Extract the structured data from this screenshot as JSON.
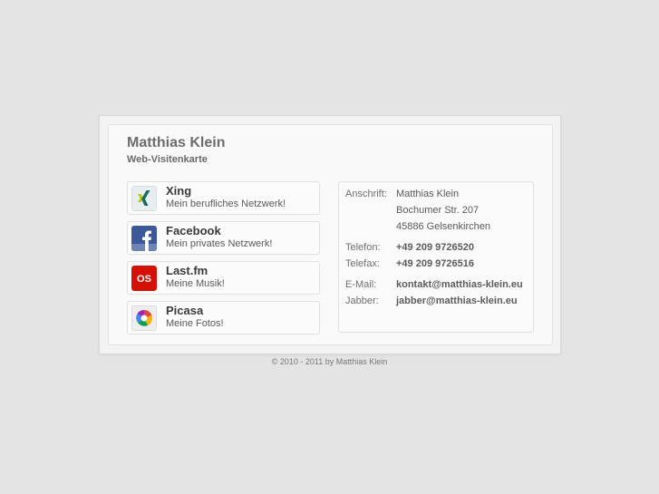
{
  "card": {
    "name": "Matthias Klein",
    "subtitle": "Web-Visitenkarte"
  },
  "links": [
    {
      "title": "Xing",
      "desc": "Mein berufliches Netzwerk!",
      "icon": "xing-icon"
    },
    {
      "title": "Facebook",
      "desc": "Mein privates Netzwerk!",
      "icon": "facebook-icon"
    },
    {
      "title": "Last.fm",
      "desc": "Meine Musik!",
      "icon": "lastfm-icon"
    },
    {
      "title": "Picasa",
      "desc": "Meine Fotos!",
      "icon": "picasa-icon"
    }
  ],
  "contact": {
    "address_label": "Anschrift:",
    "address_line1": "Matthias Klein",
    "address_line2": "Bochumer Str. 207",
    "address_line3": "45886 Gelsenkirchen",
    "phone_label": "Telefon:",
    "phone": "+49 209 9726520",
    "fax_label": "Telefax:",
    "fax": "+49 209 9726516",
    "email_label": "E-Mail:",
    "email": "kontakt@matthias-klein.eu",
    "jabber_label": "Jabber:",
    "jabber": "jabber@matthias-klein.eu"
  },
  "footer": "© 2010 - 2011 by Matthias Klein"
}
